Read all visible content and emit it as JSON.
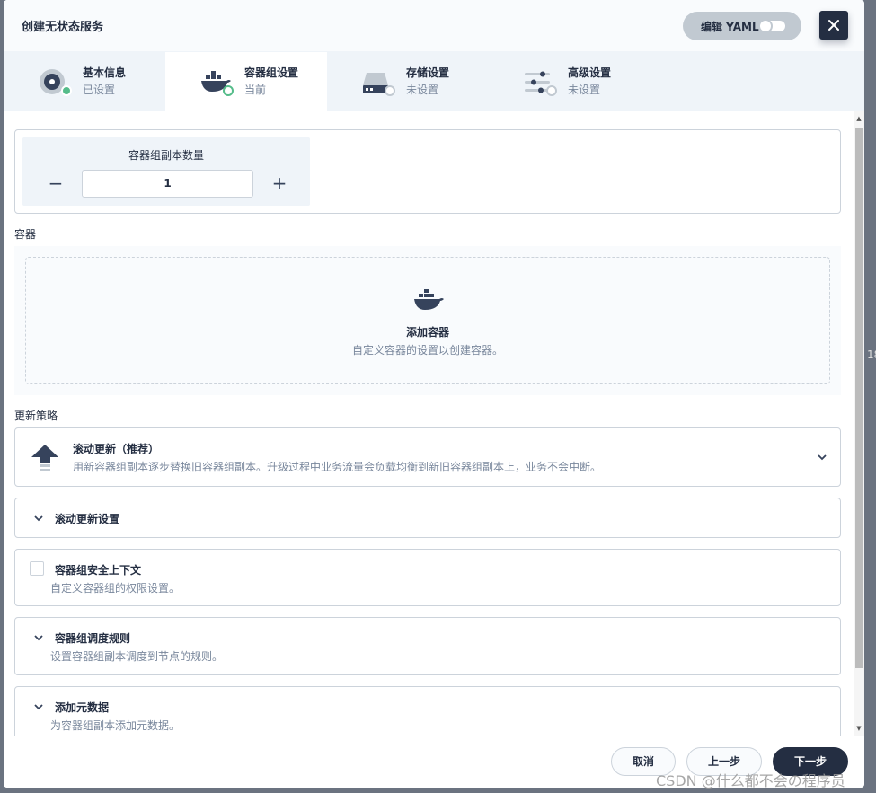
{
  "modal": {
    "title": "创建无状态服务",
    "yaml_label": "编辑 YAML",
    "close_symbol": "✕"
  },
  "tabs": [
    {
      "title": "基本信息",
      "status": "已设置"
    },
    {
      "title": "容器组设置",
      "status": "当前"
    },
    {
      "title": "存储设置",
      "status": "未设置"
    },
    {
      "title": "高级设置",
      "status": "未设置"
    }
  ],
  "replicas": {
    "label": "容器组副本数量",
    "value": "1",
    "minus": "−",
    "plus": "+"
  },
  "containers": {
    "section_label": "容器",
    "add_title": "添加容器",
    "add_desc": "自定义容器的设置以创建容器。"
  },
  "update_strategy": {
    "section_label": "更新策略",
    "title": "滚动更新（推荐）",
    "desc": "用新容器组副本逐步替换旧容器组副本。升级过程中业务流量会负载均衡到新旧容器组副本上，业务不会中断。"
  },
  "rolling_settings": {
    "title": "滚动更新设置"
  },
  "security_context": {
    "title": "容器组安全上下文",
    "desc": "自定义容器组的权限设置。"
  },
  "scheduling": {
    "title": "容器组调度规则",
    "desc": "设置容器组副本调度到节点的规则。"
  },
  "metadata": {
    "title": "添加元数据",
    "desc": "为容器组副本添加元数据。"
  },
  "footer": {
    "cancel": "取消",
    "prev": "上一步",
    "next": "下一步"
  },
  "watermark": "CSDN @什么都不会の程序员",
  "background_fragment": "18",
  "colors": {
    "dark": "#242e42",
    "green": "#55bc8a",
    "border": "#ccd3db",
    "muted": "#79879c"
  }
}
